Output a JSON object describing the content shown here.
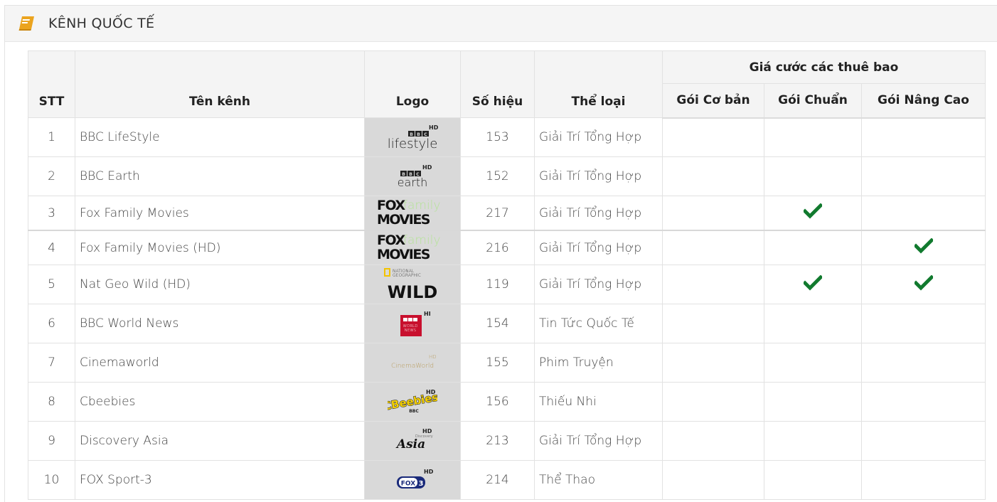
{
  "header": {
    "title": "KÊNH QUỐC TẾ",
    "icon": "book-icon"
  },
  "table": {
    "columns": {
      "stt": "STT",
      "name": "Tên kênh",
      "logo": "Logo",
      "number": "Số hiệu",
      "genre": "Thể loại",
      "price_group": "Giá cước các thuê bao",
      "basic": "Gói Cơ bản",
      "standard": "Gói Chuẩn",
      "advanced": "Gói Nâng Cao"
    },
    "rows": [
      {
        "stt": "1",
        "name": "BBC LifeStyle",
        "logo": "bbc-lifestyle-logo",
        "number": "153",
        "genre": "Giải Trí Tổng Hợp",
        "basic": false,
        "standard": false,
        "advanced": false
      },
      {
        "stt": "2",
        "name": "BBC Earth",
        "logo": "bbc-earth-logo",
        "number": "152",
        "genre": "Giải Trí Tổng Hợp",
        "basic": false,
        "standard": false,
        "advanced": false
      },
      {
        "stt": "3",
        "name": "Fox Family Movies",
        "logo": "fox-family-movies-logo",
        "number": "217",
        "genre": "Giải Trí Tổng Hợp",
        "basic": false,
        "standard": true,
        "advanced": false
      },
      {
        "stt": "4",
        "name": "Fox Family Movies (HD)",
        "logo": "fox-family-movies-logo",
        "number": "216",
        "genre": "Giải Trí Tổng Hợp",
        "basic": false,
        "standard": false,
        "advanced": true
      },
      {
        "stt": "5",
        "name": "Nat Geo Wild (HD)",
        "logo": "nat-geo-wild-logo",
        "number": "119",
        "genre": "Giải Trí Tổng Hợp",
        "basic": false,
        "standard": true,
        "advanced": true
      },
      {
        "stt": "6",
        "name": "BBC World News",
        "logo": "bbc-world-news-logo",
        "number": "154",
        "genre": "Tin Tức Quốc Tế",
        "basic": false,
        "standard": false,
        "advanced": false
      },
      {
        "stt": "7",
        "name": "Cinemaworld",
        "logo": "cinemaworld-logo",
        "number": "155",
        "genre": "Phim Truyện",
        "basic": false,
        "standard": false,
        "advanced": false
      },
      {
        "stt": "8",
        "name": "Cbeebies",
        "logo": "cbeebies-logo",
        "number": "156",
        "genre": "Thiếu Nhi",
        "basic": false,
        "standard": false,
        "advanced": false
      },
      {
        "stt": "9",
        "name": "Discovery Asia",
        "logo": "discovery-asia-logo",
        "number": "213",
        "genre": "Giải Trí Tổng Hợp",
        "basic": false,
        "standard": false,
        "advanced": false
      },
      {
        "stt": "10",
        "name": "FOX Sport-3",
        "logo": "fox-sport-3-logo",
        "number": "214",
        "genre": "Thể Thao",
        "basic": false,
        "standard": false,
        "advanced": false
      }
    ]
  },
  "logos": {
    "bbc_lifestyle": {
      "hd": "HD",
      "brand": "BBC",
      "word": "lifestyle"
    },
    "bbc_earth": {
      "hd": "HD",
      "brand": "BBC",
      "word": "earth"
    },
    "fox_family": {
      "fox": "FOX",
      "family": "family",
      "movies": "MOVIES"
    },
    "natgeo": {
      "line1": "NATIONAL",
      "line2": "GEOGRAPHIC",
      "word": "WILD"
    },
    "bbc_world": {
      "hd": "HD",
      "brand": "BBC",
      "l2": "WORLD",
      "l3": "NEWS"
    },
    "cinemaworld": {
      "hd": "HD",
      "word": "CinemaWorld"
    },
    "cbeebies": {
      "hd": "HD",
      "word": "CBeebies",
      "brand": "BBC"
    },
    "discovery_asia": {
      "hd": "HD",
      "word": "Asia",
      "brand": "Discovery"
    },
    "fox_sport": {
      "hd": "HD",
      "word": "FOX",
      "num": "3"
    }
  },
  "colors": {
    "check": "#117a2e",
    "accent": "#e8a21b",
    "logo_bg": "#d9d9d9"
  }
}
